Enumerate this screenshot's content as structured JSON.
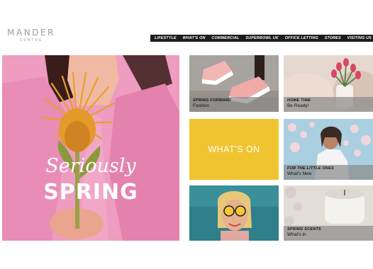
{
  "brand": {
    "name": "MANDER",
    "sub": "CENTRE"
  },
  "nav": {
    "items": [
      "LIFESTYLE",
      "WHAT'S ON",
      "COMMERCIAL",
      "SUPERBOWL UK",
      "OFFICE LETTING",
      "STORES",
      "VISITING US"
    ]
  },
  "hero": {
    "line1": "Seriously",
    "line2": "SPRING"
  },
  "tiles": {
    "spring_forward": {
      "title": "SPRING FORWARD",
      "subtitle": "Fashion"
    },
    "home_time": {
      "title": "HOME TIME",
      "subtitle": "Be Ready!"
    },
    "whats_on": {
      "label": "WHAT'S ON"
    },
    "little_ones": {
      "title": "FOR THE LITTLE ONES",
      "subtitle": "What's New"
    },
    "spring_scents": {
      "title": "SPRING SCENTS",
      "subtitle": "What's in"
    }
  },
  "colors": {
    "nav_bg": "#1c1c1c",
    "whats_on_bg": "#f0c430",
    "hero_bg": "#ee98bd",
    "logo_text": "#9e9e9e"
  }
}
